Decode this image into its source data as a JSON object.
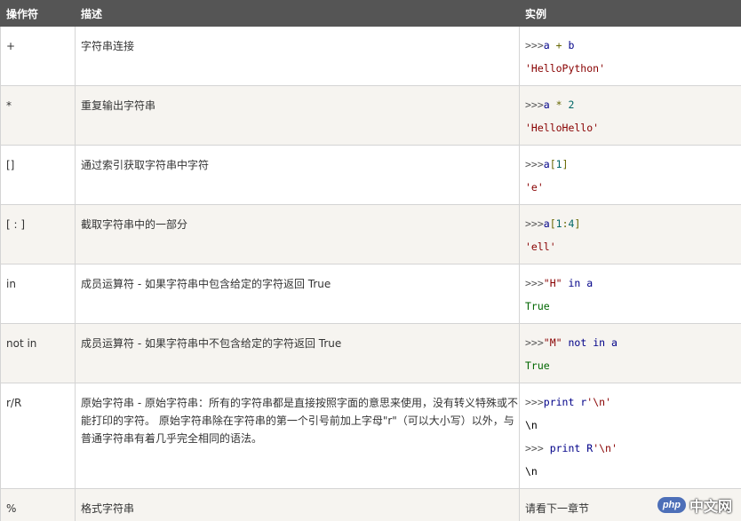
{
  "headers": {
    "operator": "操作符",
    "description": "描述",
    "example": "实例"
  },
  "rows": [
    {
      "operator": "+",
      "description": "字符串连接",
      "example": [
        [
          {
            "t": ">>>",
            "c": "prompt"
          },
          {
            "t": "a",
            "c": "code-var"
          },
          {
            "t": " + ",
            "c": "code-op"
          },
          {
            "t": "b",
            "c": "code-var"
          }
        ],
        [
          {
            "t": "'HelloPython'",
            "c": "code-out-str"
          }
        ]
      ]
    },
    {
      "operator": "*",
      "description": "重复输出字符串",
      "example": [
        [
          {
            "t": ">>>",
            "c": "prompt"
          },
          {
            "t": "a",
            "c": "code-var"
          },
          {
            "t": " * ",
            "c": "code-op"
          },
          {
            "t": "2",
            "c": "code-num"
          }
        ],
        [
          {
            "t": "'HelloHello'",
            "c": "code-out-str"
          }
        ]
      ]
    },
    {
      "operator": "[]",
      "description": "通过索引获取字符串中字符",
      "example": [
        [
          {
            "t": ">>>",
            "c": "prompt"
          },
          {
            "t": "a",
            "c": "code-var"
          },
          {
            "t": "[",
            "c": "code-op"
          },
          {
            "t": "1",
            "c": "code-num"
          },
          {
            "t": "]",
            "c": "code-op"
          }
        ],
        [
          {
            "t": "'e'",
            "c": "code-out-str"
          }
        ]
      ]
    },
    {
      "operator": "[ : ]",
      "description": "截取字符串中的一部分",
      "example": [
        [
          {
            "t": ">>>",
            "c": "prompt"
          },
          {
            "t": "a",
            "c": "code-var"
          },
          {
            "t": "[",
            "c": "code-op"
          },
          {
            "t": "1",
            "c": "code-num"
          },
          {
            "t": ":",
            "c": "code-op"
          },
          {
            "t": "4",
            "c": "code-num"
          },
          {
            "t": "]",
            "c": "code-op"
          }
        ],
        [
          {
            "t": "'ell'",
            "c": "code-out-str"
          }
        ]
      ]
    },
    {
      "operator": "in",
      "description": "成员运算符 - 如果字符串中包含给定的字符返回 True",
      "example": [
        [
          {
            "t": ">>>",
            "c": "prompt"
          },
          {
            "t": "\"H\"",
            "c": "code-str"
          },
          {
            "t": " ",
            "c": "code-op"
          },
          {
            "t": "in",
            "c": "code-kw"
          },
          {
            "t": " ",
            "c": "code-op"
          },
          {
            "t": "a",
            "c": "code-var"
          }
        ],
        [
          {
            "t": "True",
            "c": "code-true"
          }
        ]
      ]
    },
    {
      "operator": "not in",
      "description": "成员运算符 - 如果字符串中不包含给定的字符返回 True",
      "example": [
        [
          {
            "t": ">>>",
            "c": "prompt"
          },
          {
            "t": "\"M\"",
            "c": "code-str"
          },
          {
            "t": " ",
            "c": "code-op"
          },
          {
            "t": "not",
            "c": "code-kw"
          },
          {
            "t": " ",
            "c": "code-op"
          },
          {
            "t": "in",
            "c": "code-kw"
          },
          {
            "t": " ",
            "c": "code-op"
          },
          {
            "t": "a",
            "c": "code-var"
          }
        ],
        [
          {
            "t": "True",
            "c": "code-true"
          }
        ]
      ]
    },
    {
      "operator": "r/R",
      "description": "原始字符串 - 原始字符串：所有的字符串都是直接按照字面的意思来使用，没有转义特殊或不能打印的字符。 原始字符串除在字符串的第一个引号前加上字母\"r\"（可以大小写）以外，与普通字符串有着几乎完全相同的语法。",
      "example": [
        [
          {
            "t": ">>>",
            "c": "prompt"
          },
          {
            "t": "print",
            "c": "code-kw"
          },
          {
            "t": " r",
            "c": "code-var"
          },
          {
            "t": "'\\n'",
            "c": "code-str"
          }
        ],
        [
          {
            "t": "\\n",
            "c": "code-out-esc"
          }
        ],
        [
          {
            "t": ">>> ",
            "c": "prompt"
          },
          {
            "t": "print",
            "c": "code-kw"
          },
          {
            "t": " R",
            "c": "code-var"
          },
          {
            "t": "'\\n'",
            "c": "code-str"
          }
        ],
        [
          {
            "t": "\\n",
            "c": "code-out-esc"
          }
        ]
      ]
    },
    {
      "operator": "%",
      "description": "格式字符串",
      "example_text": "请看下一章节"
    }
  ],
  "watermark": {
    "logo": "php",
    "text": "中文网"
  }
}
